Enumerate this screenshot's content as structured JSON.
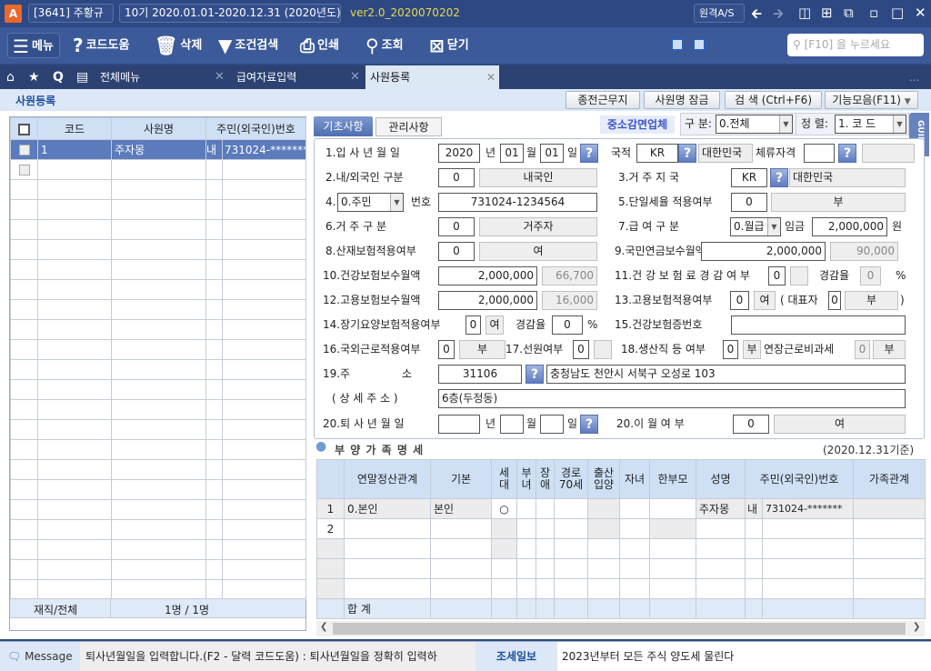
{
  "titlebar": {
    "app_icon": "A",
    "company": "[3641] 주황규",
    "period": "10기  2020.01.01-2020.12.31",
    "year": "(2020년도)",
    "version": "ver2.0_2020070202",
    "remote": "원격A/S"
  },
  "toolbar": {
    "menu": "메뉴",
    "code_help": "코드도움",
    "delete": "삭제",
    "filter": "조건검색",
    "print": "인쇄",
    "search": "조회",
    "close": "닫기",
    "search_placeholder": "[F10] 을 누르세요"
  },
  "tabs": {
    "all_menu": "전체메뉴",
    "payroll": "급여자료입력",
    "employee": "사원등록",
    "more": "..."
  },
  "subhead": {
    "title": "사원등록",
    "btn_prev_work": "종전근무지",
    "btn_lock": "사원명 잠금",
    "btn_search": "검  색 (Ctrl+F6)",
    "btn_functions": "기능모음(F11)"
  },
  "left": {
    "headers": [
      "코드",
      "사원명",
      "주민(외국인)번호"
    ],
    "rows": [
      {
        "code": "1",
        "name": "주자몽",
        "type": "내",
        "id": "731024-*******"
      }
    ],
    "footer_label": "재직/전체",
    "footer_value": "1명 / 1명"
  },
  "form_tabs": {
    "basic": "기초사항",
    "manage": "관리사항",
    "sme": "중소감면업체",
    "division_label": "구 분:",
    "division_value": "0.전체",
    "sort_label": "정 렬:",
    "sort_value": "1. 코  드",
    "guide": "GUIDE"
  },
  "form": {
    "r1": {
      "label": "1.입 사 년 월 일",
      "year": "2020",
      "y": "년",
      "month": "01",
      "m": "월",
      "day": "01",
      "d": "일",
      "nat_label": "국적",
      "nat_code": "KR",
      "nat_name": "대한민국",
      "stay_label": "체류자격",
      "stay_code": "",
      "stay_name": ""
    },
    "r2": {
      "label": "2.내/외국인 구분",
      "code": "0",
      "name": "내국인",
      "label3": "3.거 주 지 국",
      "code3": "KR",
      "name3": "대한민국"
    },
    "r3": {
      "label": "4.",
      "select": "0.주민",
      "num_label": "번호",
      "num": "731024-1234564",
      "label5": "5.단일세율 적용여부",
      "code5": "0",
      "name5": "부"
    },
    "r4": {
      "label": "6.거  주  구  분",
      "code": "0",
      "name": "거주자",
      "label7": "7.급  여  구  분",
      "select7": "0.월급",
      "wage_label": "임금",
      "wage": "2,000,000",
      "won": "원"
    },
    "r5": {
      "label": "8.산재보험적용여부",
      "code": "0",
      "name": "여",
      "label9": "9.국민연금보수월액",
      "amount9": "2,000,000",
      "calc9": "90,000"
    },
    "r6": {
      "label": "10.건강보험보수월액",
      "amount": "2,000,000",
      "calc": "66,700",
      "label11": "11.건 강 보 험 료 경 감 여 부",
      "code11": "0",
      "name11": "",
      "rate_label": "경감율",
      "rate": "0",
      "pct": "%"
    },
    "r7": {
      "label": "12.고용보험보수월액",
      "amount": "2,000,000",
      "calc": "16,000",
      "label13": "13.고용보험적용여부",
      "code13": "0",
      "name13": "여",
      "rep_label": "( 대표자",
      "rep_code": "0",
      "rep_name": "부",
      "close": ")"
    },
    "r8": {
      "label": "14.장기요양보험적용여부",
      "code": "0",
      "name": "여",
      "rate_label": "경감율",
      "rate": "0",
      "pct": "%",
      "label15": "15.건강보험증번호",
      "card": ""
    },
    "r9": {
      "label": "16.국외근로적용여부",
      "code": "0",
      "name": "부",
      "label17": "17.선원여부",
      "code17": "0",
      "name17": "",
      "label18": "18.생산직 등 여부",
      "code18": "0",
      "name18": "부",
      "ot_label": "연장근로비과세",
      "ot_code": "0",
      "ot_name": "부"
    },
    "r10": {
      "label": "19.주",
      "label2": "소",
      "zip": "31106",
      "addr": "충청남도 천안시 서북구  오성로 103"
    },
    "r11": {
      "label": "( 상  세  주  소 )",
      "detail": "6층(두정동)"
    },
    "r12": {
      "label": "20.퇴 사 년 월 일",
      "year": "",
      "y": "년",
      "month": "",
      "m": "월",
      "day": "",
      "d": "일",
      "label20": "20.이   월   여   부",
      "code20": "0",
      "name20": "여"
    }
  },
  "family": {
    "title": "부 양 가 족 명 세",
    "basis": "(2020.12.31기준)",
    "headers": [
      "",
      "연말정산관계",
      "기본",
      "세\n대",
      "부\n녀",
      "장\n애",
      "경로\n70세",
      "출산\n입양",
      "자녀",
      "한부모",
      "성명",
      "주민(외국인)번호",
      "가족관계"
    ],
    "rows": [
      {
        "no": "1",
        "rel": "0.본인",
        "basic": "본인",
        "household": "○",
        "name": "주자몽",
        "type": "내",
        "id": "731024-*******"
      },
      {
        "no": "2"
      }
    ],
    "total": "합   계"
  },
  "status": {
    "message_label": "Message",
    "message": "퇴사년월일을 입력합니다.(F2  - 달력 코드도움) : 퇴사년월일을 정확히 입력하",
    "news_label": "조세일보",
    "news": "2023년부터 모든 주식 양도세 물린다"
  }
}
